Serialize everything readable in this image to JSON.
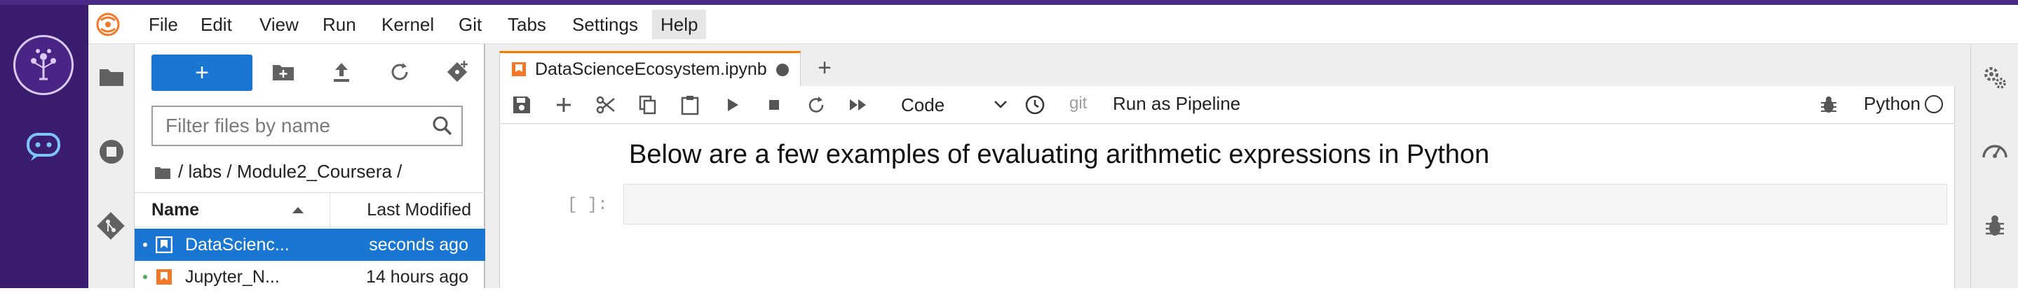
{
  "menu": {
    "items": [
      "File",
      "Edit",
      "View",
      "Run",
      "Kernel",
      "Git",
      "Tabs",
      "Settings",
      "Help"
    ],
    "active": "Help"
  },
  "sidebar_icons": [
    "folder-icon",
    "stop-circle-icon",
    "git-icon"
  ],
  "file_browser": {
    "new_label": "+",
    "filter_placeholder": "Filter files by name",
    "breadcrumb": "/ labs / Module2_Coursera /",
    "columns": {
      "name": "Name",
      "modified": "Last Modified"
    },
    "files": [
      {
        "name": "DataScienc...",
        "modified": "seconds ago",
        "selected": true
      },
      {
        "name": "Jupyter_N...",
        "modified": "14 hours ago",
        "selected": false
      }
    ]
  },
  "notebook": {
    "tab_title": "DataScienceEcosystem.ipynb",
    "tab_add": "+",
    "cell_type": "Code",
    "git_label": "git",
    "pipeline_label": "Run as Pipeline",
    "kernel_name": "Python",
    "markdown_heading": "Below are a few examples of evaluating arithmetic expressions in Python",
    "code_prompt": "[ ]:"
  },
  "colors": {
    "accent": "#1976d2",
    "rail": "#3b1d70",
    "tab_accent": "#f57c00"
  }
}
